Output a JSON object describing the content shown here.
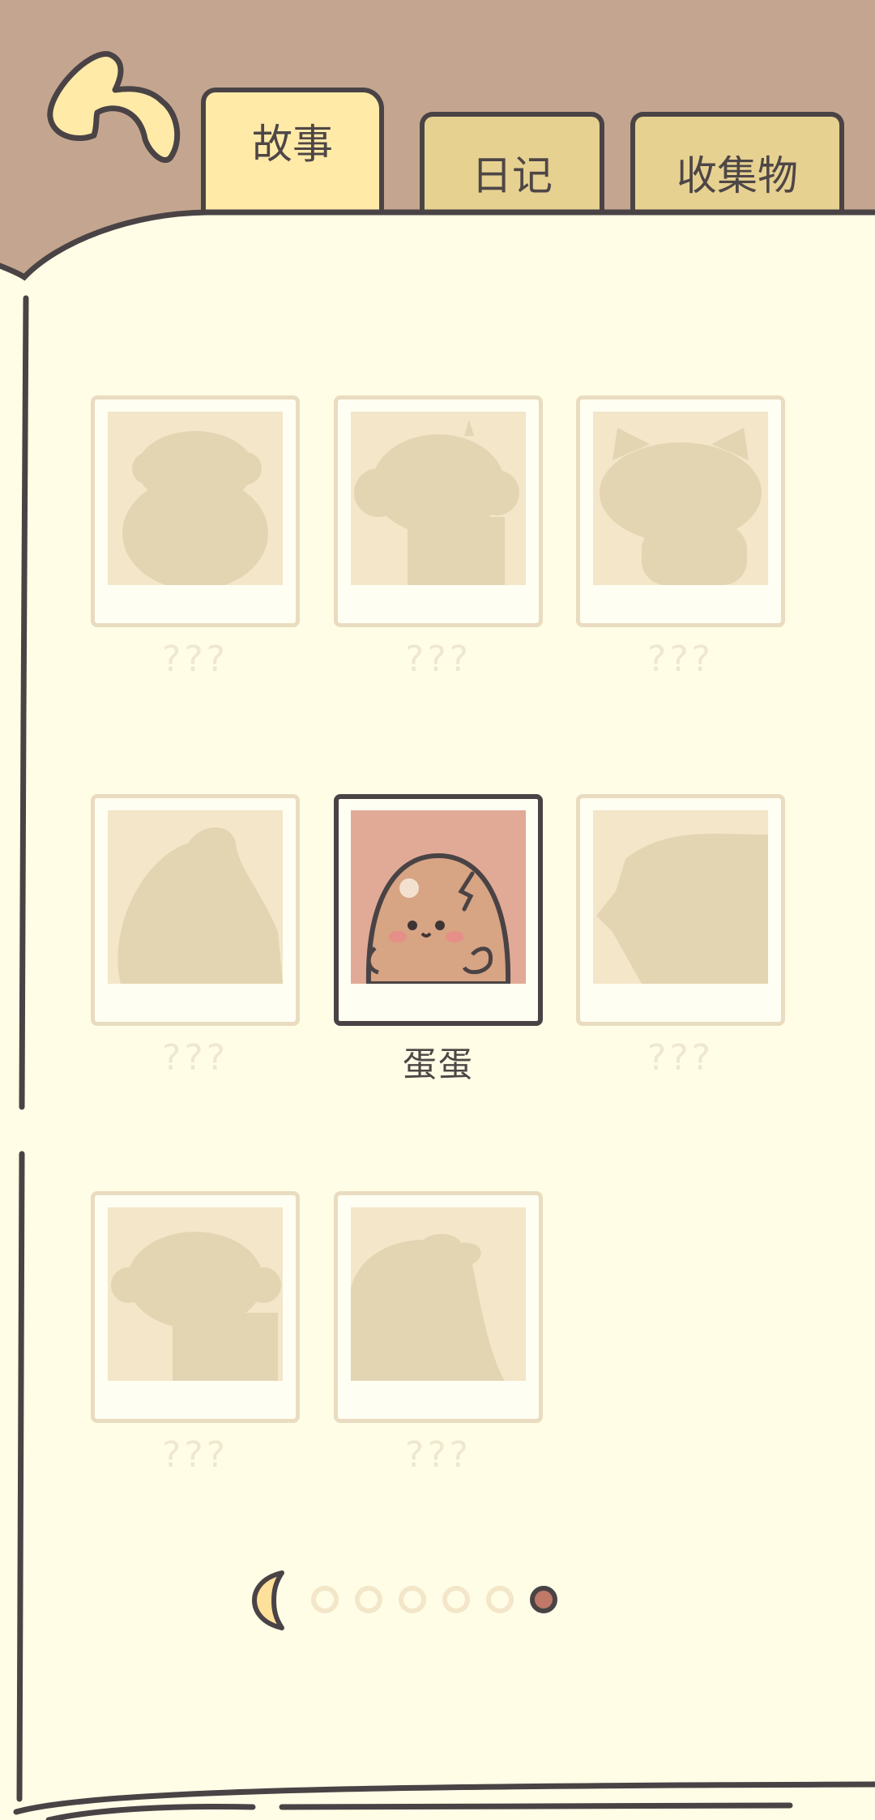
{
  "tabs": [
    {
      "label": "故事",
      "active": true
    },
    {
      "label": "日记",
      "active": false
    },
    {
      "label": "收集物",
      "active": false
    }
  ],
  "cards": [
    {
      "name": "???",
      "unlocked": false
    },
    {
      "name": "???",
      "unlocked": false
    },
    {
      "name": "???",
      "unlocked": false
    },
    {
      "name": "???",
      "unlocked": false
    },
    {
      "name": "蛋蛋",
      "unlocked": true
    },
    {
      "name": "???",
      "unlocked": false
    },
    {
      "name": "???",
      "unlocked": false
    },
    {
      "name": "???",
      "unlocked": false
    }
  ],
  "pagination": {
    "total": 6,
    "current": 6
  },
  "colors": {
    "header_bg": "#c4a690",
    "page_bg": "#fffde6",
    "outline": "#4a4345",
    "tab_active": "#ffeaa8",
    "tab_inactive": "#e6d191",
    "locked_frame": "#e9dcc0",
    "silhouette": "#e3d5b2",
    "active_photo_bg": "#e1aa97",
    "current_dot": "#c07868"
  }
}
